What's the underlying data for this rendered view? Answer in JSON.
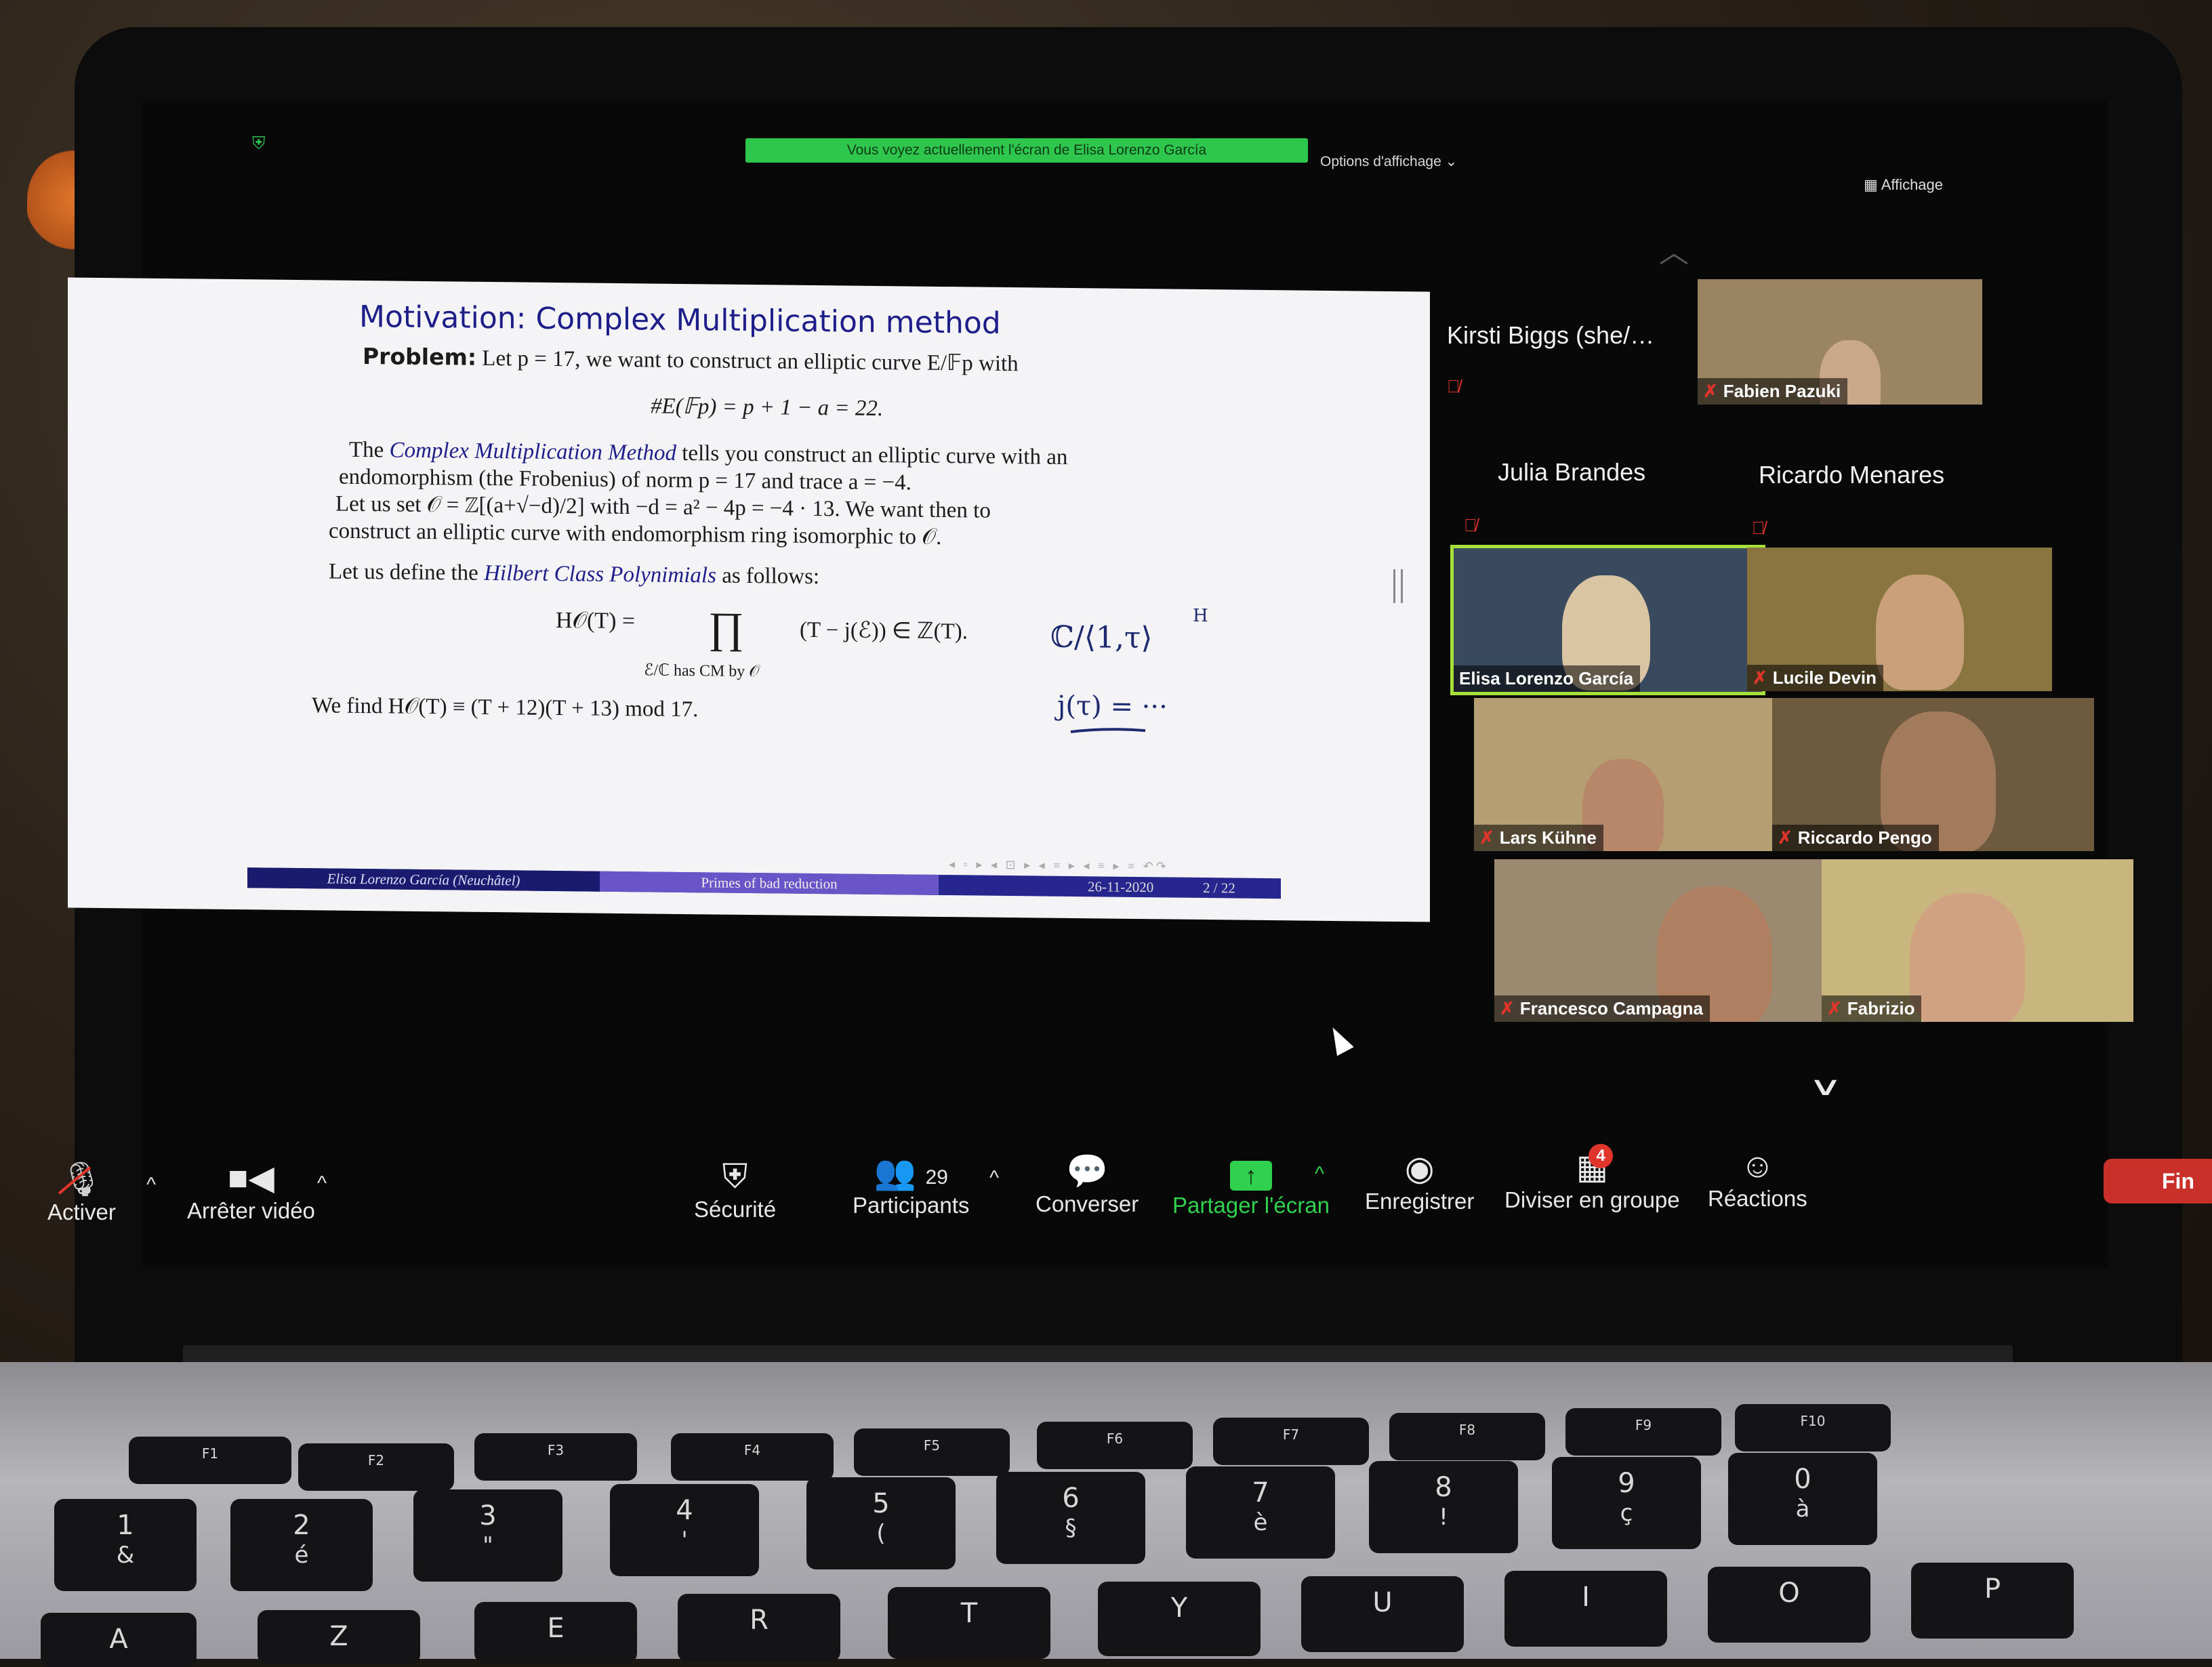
{
  "banner": {
    "sharing_text": "Vous voyez actuellement l'écran de Elisa Lorenzo García",
    "view_options": "Options d'affichage ⌄",
    "view_button": "Affichage"
  },
  "slide": {
    "title": "Motivation: Complex Multiplication method",
    "problem_label": "Problem:",
    "problem_text": "Let p = 17, we want to construct an elliptic curve E/𝔽p with",
    "equation_count": "#E(𝔽p) = p + 1 − a = 22.",
    "cm_line1_pre": "The",
    "cm_method_term": "Complex Multiplication Method",
    "cm_line1_post": "tells you construct an elliptic curve with an",
    "cm_line2": "endomorphism (the Frobenius) of norm p = 17 and trace a = −4.",
    "order_line1": "Let us set 𝒪 = ℤ[(a+√−d)/2] with −d = a² − 4p = −4 · 13. We want then to",
    "order_line2": "construct an elliptic curve with endomorphism ring isomorphic to 𝒪.",
    "define_pre": "Let us define the",
    "hilbert_term": "Hilbert Class Polynimials",
    "define_post": "as follows:",
    "hilbert_lhs": "H𝒪(T) =",
    "hilbert_product": "∏",
    "hilbert_rhs": "(T − j(ℰ)) ∈ ℤ(T).",
    "hilbert_subscript": "ℰ/ℂ has CM by 𝒪",
    "result_line": "We find H𝒪(T) ≡ (T + 12)(T + 13) mod 17.",
    "footer_author": "Elisa Lorenzo García (Neuchâtel)",
    "footer_talk": "Primes of bad reduction",
    "footer_date": "26-11-2020",
    "footer_page": "2 / 22",
    "nav_symbols": "◂ ▫ ▸ ◂ ⊡ ▸ ◂ ≡ ▸ ◂ ≡ ▸ ≡ ↶↷"
  },
  "handwriting": {
    "line1": "ℂ/⟨1,τ⟩",
    "superscript": "H",
    "line2": "j(τ) = ···"
  },
  "participants": {
    "name_tiles": [
      {
        "name": "Kirsti Biggs (she/…",
        "muted": true
      },
      {
        "name": "Julia Brandes",
        "muted": true
      },
      {
        "name": "Ricardo Menares",
        "muted": true
      }
    ],
    "video_tiles": [
      {
        "name": "Fabien Pazuki",
        "muted": true
      },
      {
        "name": "Elisa Lorenzo García",
        "muted": false
      },
      {
        "name": "Lucile Devin",
        "muted": true
      },
      {
        "name": "Lars Kühne",
        "muted": true
      },
      {
        "name": "Riccardo Pengo",
        "muted": true
      },
      {
        "name": "Francesco Campagna",
        "muted": true
      },
      {
        "name": "Fabrizio",
        "muted": true
      }
    ],
    "mute_icon": "mic-muted-icon"
  },
  "toolbar": {
    "unmute_label": "Activer",
    "stop_video_label": "Arrêter vidéo",
    "security_label": "Sécurité",
    "participants_label": "Participants",
    "participants_count": "29",
    "chat_label": "Converser",
    "share_label": "Partager l'écran",
    "record_label": "Enregistrer",
    "breakout_label": "Diviser en groupe",
    "breakout_badge": "4",
    "reactions_label": "Réactions",
    "end_label": "Fin"
  },
  "keyboard": {
    "fkeys": [
      "F1",
      "F2",
      "F3",
      "F4",
      "F5",
      "F6",
      "F7",
      "F8",
      "F9",
      "F10"
    ],
    "number_keys": [
      {
        "top": "1",
        "bottom": "&"
      },
      {
        "top": "2",
        "bottom": "é"
      },
      {
        "top": "3",
        "bottom": "\""
      },
      {
        "top": "4",
        "bottom": "'"
      },
      {
        "top": "5",
        "bottom": "("
      },
      {
        "top": "6",
        "bottom": "§"
      },
      {
        "top": "7",
        "bottom": "è"
      },
      {
        "top": "8",
        "bottom": "!"
      },
      {
        "top": "9",
        "bottom": "ç"
      },
      {
        "top": "0",
        "bottom": "à"
      }
    ],
    "letter_keys": [
      "A",
      "Z",
      "E",
      "R",
      "T",
      "Y",
      "U",
      "I",
      "O",
      "P"
    ]
  },
  "colors": {
    "share_green": "#2fc64d",
    "mute_red": "#e0352b",
    "active_speaker_border": "#a8e03a",
    "slide_accent": "#1e1e8a"
  }
}
